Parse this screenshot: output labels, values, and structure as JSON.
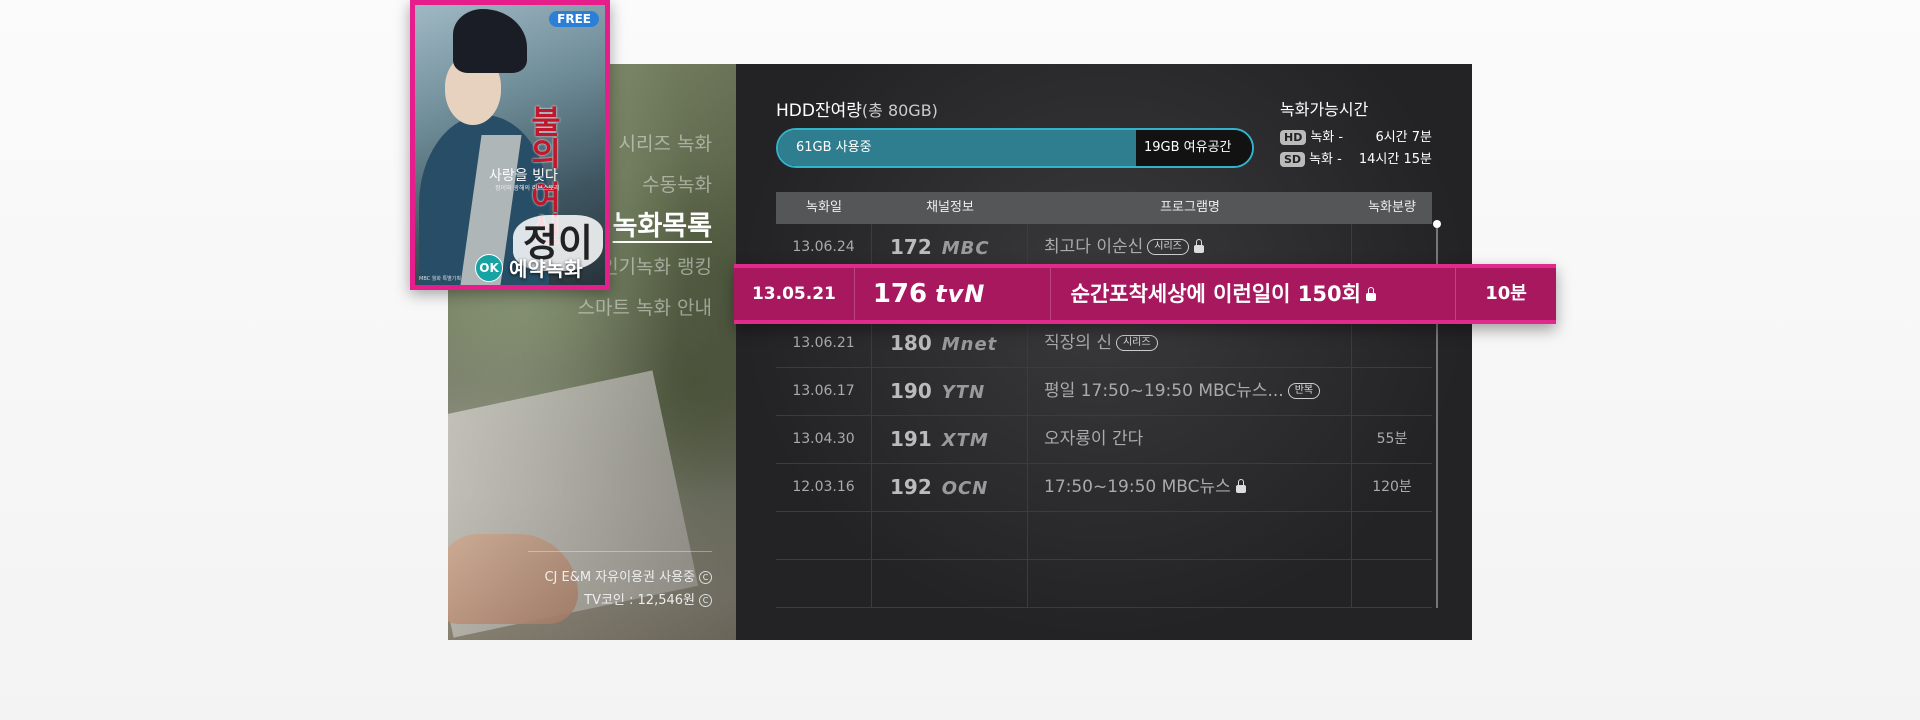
{
  "menu": {
    "items": [
      "시리즈 녹화",
      "수동녹화",
      "녹화목록",
      "인기녹화 랭킹",
      "스마트 녹화 안내"
    ],
    "active_index": 2
  },
  "left_footer": {
    "line1": "CJ E&M 자유이용권 사용중",
    "line2": "TV코인 : 12,546원"
  },
  "hdd": {
    "title": "HDD잔여량",
    "total": "(총 80GB)",
    "used_label": "61GB 사용중",
    "free_label": "19GB 여유공간",
    "used_fraction": 0.7625
  },
  "record_time": {
    "title": "녹화가능시간",
    "rows": [
      {
        "quality": "HD",
        "label": "녹화 -",
        "time": "6시간 7분"
      },
      {
        "quality": "SD",
        "label": "녹화 -",
        "time": "14시간 15분"
      }
    ]
  },
  "table": {
    "headers": [
      "녹화일",
      "채널정보",
      "프로그램명",
      "녹화분량"
    ],
    "rows": [
      {
        "date": "13.06.24",
        "ch": "172",
        "logo": "MBC",
        "program": "최고다 이순신",
        "tag": "시리즈",
        "lock": true,
        "duration": ""
      },
      {
        "date": "13.05.21",
        "ch": "176",
        "logo": "tvN",
        "program": "순간포착세상에 이런일이 150회",
        "tag": "",
        "lock": true,
        "duration": "10분"
      },
      {
        "date": "13.06.21",
        "ch": "180",
        "logo": "Mnet",
        "program": "직장의 신",
        "tag": "시리즈",
        "lock": false,
        "duration": ""
      },
      {
        "date": "13.06.17",
        "ch": "190",
        "logo": "YTN",
        "program": "평일 17:50~19:50 MBC뉴스...",
        "tag": "반복",
        "lock": false,
        "duration": ""
      },
      {
        "date": "13.04.30",
        "ch": "191",
        "logo": "XTM",
        "program": "오자룡이 간다",
        "tag": "",
        "lock": false,
        "duration": "55분"
      },
      {
        "date": "12.03.16",
        "ch": "192",
        "logo": "OCN",
        "program": "17:50~19:50 MBC뉴스",
        "tag": "",
        "lock": true,
        "duration": "120분"
      }
    ],
    "selected_index": 1
  },
  "poster": {
    "free_badge": "FREE",
    "title": "불의 여신",
    "calligraphy": "정이",
    "tagline": "사랑을 빚다",
    "tagline_sub": "정이와 광해의 러브스토리",
    "small_text": "MBC 월화 특별기획",
    "ok_key": "OK",
    "action_label": "예약녹화"
  },
  "colors": {
    "accent_pink": "#e61e8c",
    "selected_row": "#a8185f",
    "hdd_used": "#2f7e8f",
    "hdd_border": "#33b3c9"
  }
}
